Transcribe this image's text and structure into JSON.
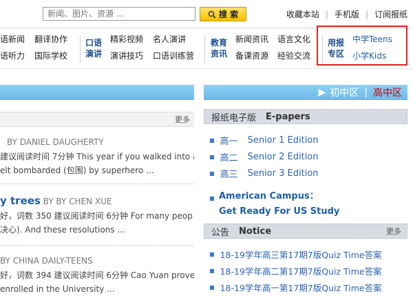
{
  "header": {
    "search_placeholder": "新闻、图片、资源 ...",
    "search_button": "搜 索",
    "links": [
      "收藏本站",
      "手机版",
      "订阅报纸"
    ]
  },
  "nav": {
    "group1": {
      "row1": [
        "语新闻",
        "翻译协作"
      ],
      "row2": [
        "语听力",
        "国际学校"
      ]
    },
    "group2": {
      "category": [
        "口语",
        "演讲"
      ],
      "row1": [
        "精彩视频",
        "名人演讲"
      ],
      "row2": [
        "演讲技巧",
        "口语训练营"
      ]
    },
    "group3": {
      "category": [
        "教育",
        "资讯"
      ],
      "row1": [
        "新闻资讯",
        "语言文化"
      ],
      "row2": [
        "备课资源",
        "经验交流"
      ]
    },
    "group4": {
      "category": [
        "用报",
        "专区"
      ],
      "row1": "中学Teens",
      "row2": "小学Kids"
    }
  },
  "left": {
    "more_label": "更多",
    "articles": [
      {
        "title": "",
        "byline": "BY DANIEL DAUGHERTY",
        "line1": "建议阅读时间 7分钟 This year if you walked into a",
        "line2": "elt bombarded (包围) by superhero ..."
      },
      {
        "title": "y trees",
        "byline": "BY BY CHEN XUE",
        "line1": "好，词数 350 建议阅读时间 6分钟 For many peop",
        "line2": "决心). And these resolutions ..."
      },
      {
        "title": "",
        "byline": "BY CHINA DAILY-TEENS",
        "line1": "好，词数 394 建议阅读时间 6分钟 Cao Yuan proved he",
        "line2": "enrolled in the University ..."
      }
    ]
  },
  "right": {
    "tabs": {
      "arrow": "▶",
      "middle": "初中区",
      "separator": "|",
      "high": "高中区"
    },
    "epaper": {
      "title_cn": "报纸电子版",
      "title_en": "E-papers",
      "editions": [
        {
          "cn": "高一",
          "en": "Senior 1 Edition"
        },
        {
          "cn": "高二",
          "en": "Senior 2 Edition"
        },
        {
          "cn": "高三",
          "en": "Senior 3 Edition"
        }
      ],
      "feature_line1": "American Campus：",
      "feature_line2": "Get Ready For US Study"
    },
    "notice": {
      "title_cn": "公告",
      "title_en": "Notice",
      "more_label": "更多",
      "items": [
        "18-19学年高三第17期7版Quiz Time答案",
        "18-19学年高二第17期7版Quiz Time答案",
        "18-19学年高一第17期7版Quiz Time答案"
      ]
    }
  },
  "colors": {
    "accent_blue": "#1f5ea8",
    "highlight_red": "#d22222",
    "bar_blue": "#6cb9ea"
  }
}
